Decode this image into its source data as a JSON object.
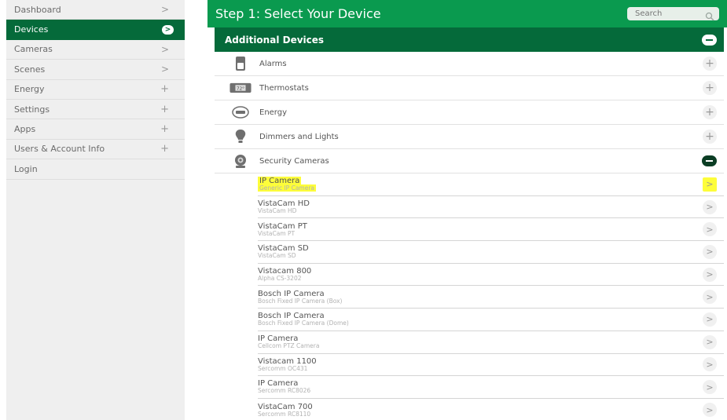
{
  "sidebar": {
    "items": [
      {
        "label": "Dashboard",
        "marker": ">"
      },
      {
        "label": "Devices",
        "marker": ">"
      },
      {
        "label": "Cameras",
        "marker": ">"
      },
      {
        "label": "Scenes",
        "marker": ">"
      },
      {
        "label": "Energy",
        "marker": "+"
      },
      {
        "label": "Settings",
        "marker": "+"
      },
      {
        "label": "Apps",
        "marker": "+"
      },
      {
        "label": "Users & Account Info",
        "marker": "+"
      },
      {
        "label": "Login",
        "marker": ""
      }
    ],
    "active_index": 1
  },
  "header": {
    "title": "Step 1: Select Your Device",
    "search_placeholder": "Search"
  },
  "panel": {
    "title": "Additional Devices",
    "categories": [
      {
        "label": "Alarms",
        "control": "+"
      },
      {
        "label": "Thermostats",
        "control": "+",
        "icon_text": "72°"
      },
      {
        "label": "Energy",
        "control": "+"
      },
      {
        "label": "Dimmers and Lights",
        "control": "+"
      },
      {
        "label": "Security Cameras",
        "control": "-"
      }
    ],
    "cameras": [
      {
        "name": "IP Camera",
        "model": "Generic IP Camera",
        "highlighted": true
      },
      {
        "name": "VistaCam HD",
        "model": "VistaCam HD"
      },
      {
        "name": "VistaCam PT",
        "model": "VistaCam PT"
      },
      {
        "name": "VistaCam SD",
        "model": "VistaCam SD"
      },
      {
        "name": "Vistacam 800",
        "model": "Alpha CS-3202"
      },
      {
        "name": "Bosch IP Camera",
        "model": "Bosch Fixed IP Camera (Box)"
      },
      {
        "name": "Bosch IP Camera",
        "model": "Bosch Fixed IP Camera (Dome)"
      },
      {
        "name": "IP Camera",
        "model": "Cellcom PTZ Camera"
      },
      {
        "name": "Vistacam 1100",
        "model": "Sercomm OC431"
      },
      {
        "name": "IP Camera",
        "model": "Sercomm RC8026"
      },
      {
        "name": "VistaCam 700",
        "model": "Sercomm RC8110"
      }
    ],
    "arrow": ">"
  },
  "colors": {
    "brand_dark": "#056a3a",
    "brand_light": "#0a9a4f",
    "highlight": "#fdfd3a"
  }
}
